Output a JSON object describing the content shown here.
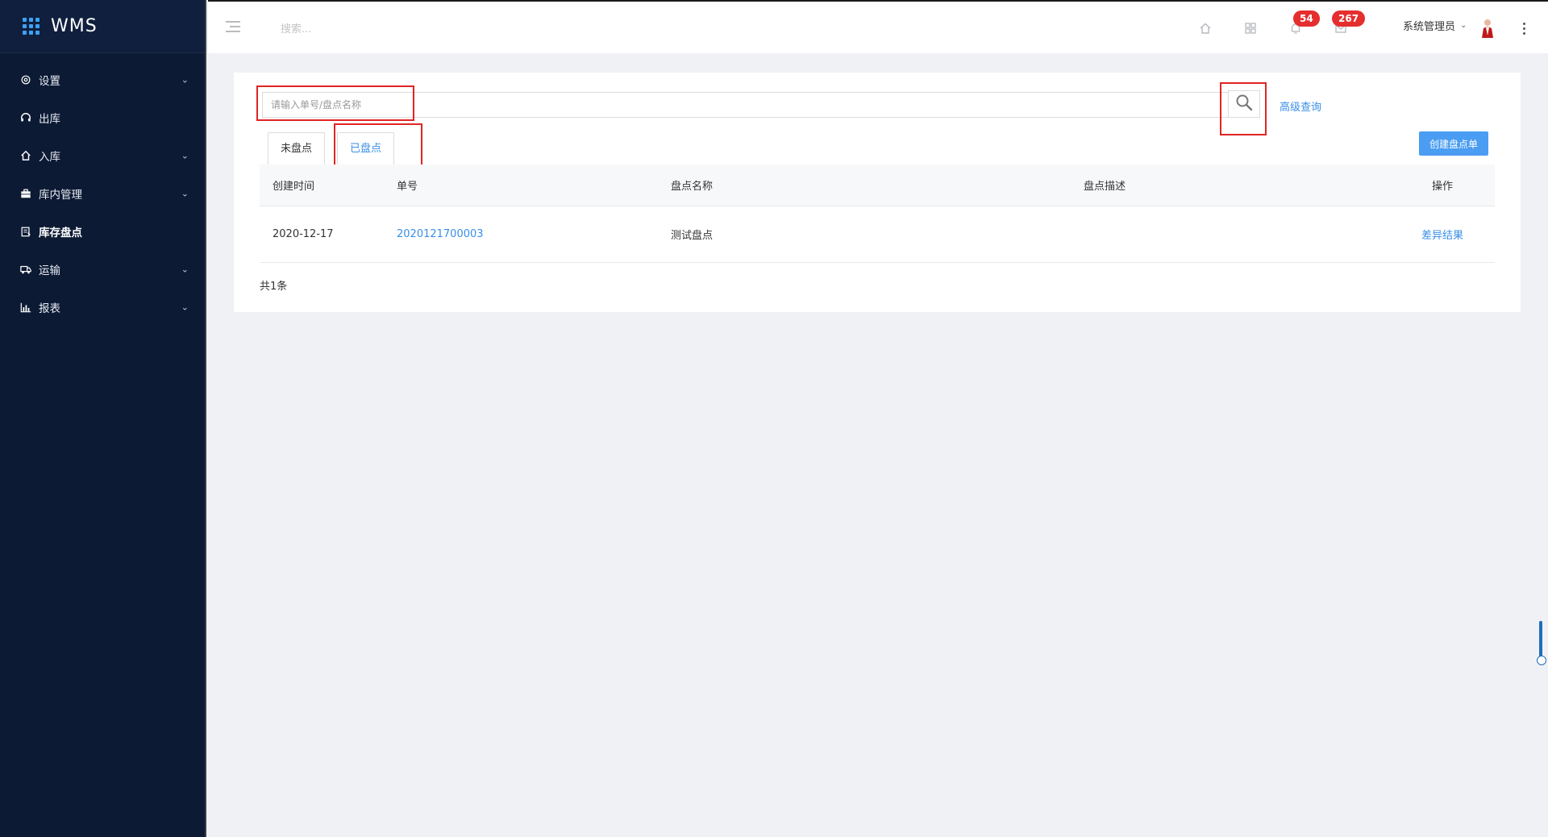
{
  "app": {
    "name": "WMS"
  },
  "sidebar": {
    "items": [
      {
        "label": "设置",
        "icon": "gear-icon",
        "has_children": true
      },
      {
        "label": "出库",
        "icon": "headset-icon",
        "has_children": false
      },
      {
        "label": "入库",
        "icon": "home-icon",
        "has_children": true
      },
      {
        "label": "库内管理",
        "icon": "briefcase-icon",
        "has_children": true
      },
      {
        "label": "库存盘点",
        "icon": "clipboard-icon",
        "has_children": false,
        "active": true
      },
      {
        "label": "运输",
        "icon": "truck-icon",
        "has_children": true
      },
      {
        "label": "报表",
        "icon": "bar-chart-icon",
        "has_children": true
      }
    ]
  },
  "topbar": {
    "search_placeholder": "搜索...",
    "notifications_count": "54",
    "messages_count": "267",
    "user_name": "系统管理员"
  },
  "filter": {
    "search_placeholder": "请输入单号/盘点名称",
    "advanced_query": "高级查询",
    "create_button": "创建盘点单"
  },
  "tabs": [
    {
      "label": "未盘点",
      "active": false
    },
    {
      "label": "已盘点",
      "active": true
    }
  ],
  "table": {
    "columns": [
      "创建时间",
      "单号",
      "盘点名称",
      "盘点描述",
      "操作"
    ],
    "rows": [
      {
        "created": "2020-12-17",
        "order_no": "2020121700003",
        "name": "测试盘点",
        "description": "",
        "action": "差异结果"
      }
    ]
  },
  "pagination": {
    "total_text": "共1条"
  },
  "colors": {
    "sidebar_bg": "#0c1a34",
    "accent": "#3a8ee6",
    "primary_button": "#4a9df2",
    "badge": "#e52e2e",
    "highlight_box": "#e02424"
  }
}
